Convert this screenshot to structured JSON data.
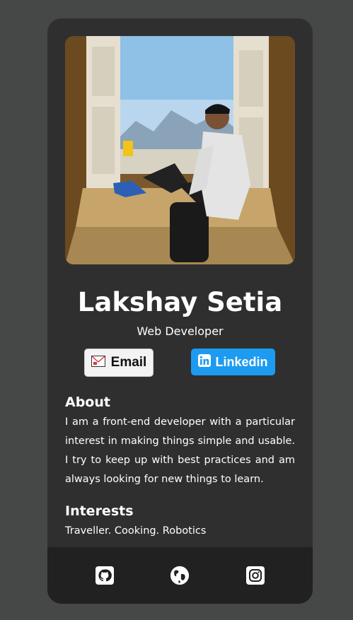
{
  "profile": {
    "name": "Lakshay Setia",
    "role": "Web Developer",
    "photo_icon": "profile-photo"
  },
  "buttons": {
    "email_label": "Email",
    "email_icon": "envelope-icon",
    "linkedin_label": "Linkedin",
    "linkedin_icon": "linkedin-icon"
  },
  "about": {
    "title": "About",
    "text": "I am a front-end developer with a particular interest in making things simple and usable. I try to keep up with best practices and am always looking for new things to learn."
  },
  "interests": {
    "title": "Interests",
    "text": "Traveller. Cooking. Robotics"
  },
  "footer": {
    "icons": [
      "github-icon",
      "globe-icon",
      "instagram-icon"
    ]
  },
  "colors": {
    "page_bg": "#464847",
    "card_bg": "#2f2f2f",
    "footer_bg": "#212121",
    "linkedin_blue": "#1d9bf0",
    "email_bg": "#f3f3f3"
  }
}
